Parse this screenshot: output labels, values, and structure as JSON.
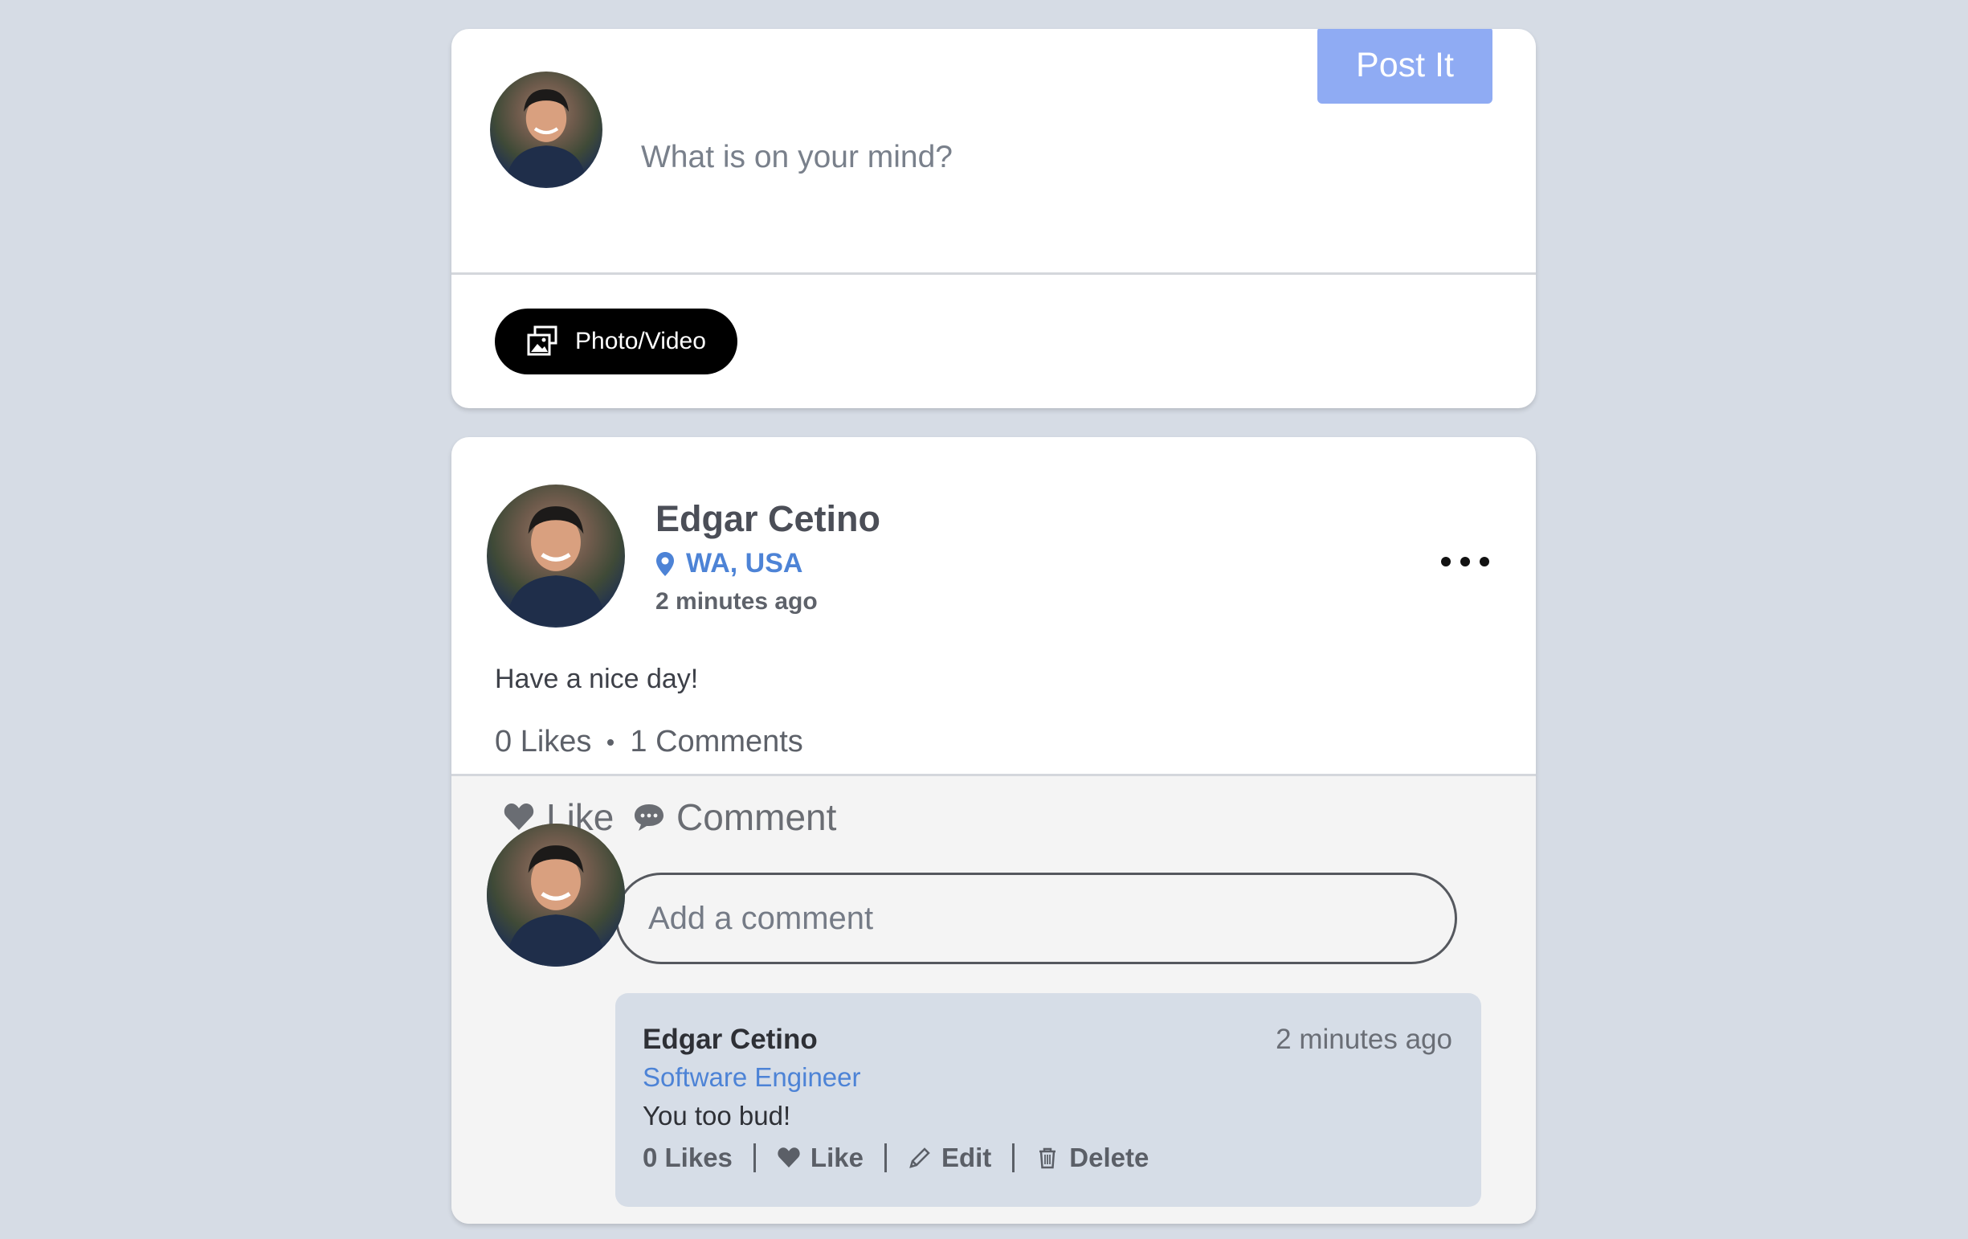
{
  "composer": {
    "placeholder": "What is on your mind?",
    "photo_button_label": "Photo/Video",
    "post_button_label": "Post It",
    "post_button_color": "#8fabf3"
  },
  "post": {
    "author": "Edgar Cetino",
    "location": "WA, USA",
    "time": "2 minutes ago",
    "text": "Have a nice day!",
    "likes_label": "0 Likes",
    "comments_label": "1 Comments",
    "like_action": "Like",
    "comment_action": "Comment",
    "comment_placeholder": "Add a comment",
    "location_color": "#4d83d6"
  },
  "comment": {
    "author": "Edgar Cetino",
    "title": "Software Engineer",
    "time": "2 minutes ago",
    "text": "You too bud!",
    "likes_label": "0 Likes",
    "like_label": "Like",
    "edit_label": "Edit",
    "delete_label": "Delete"
  }
}
